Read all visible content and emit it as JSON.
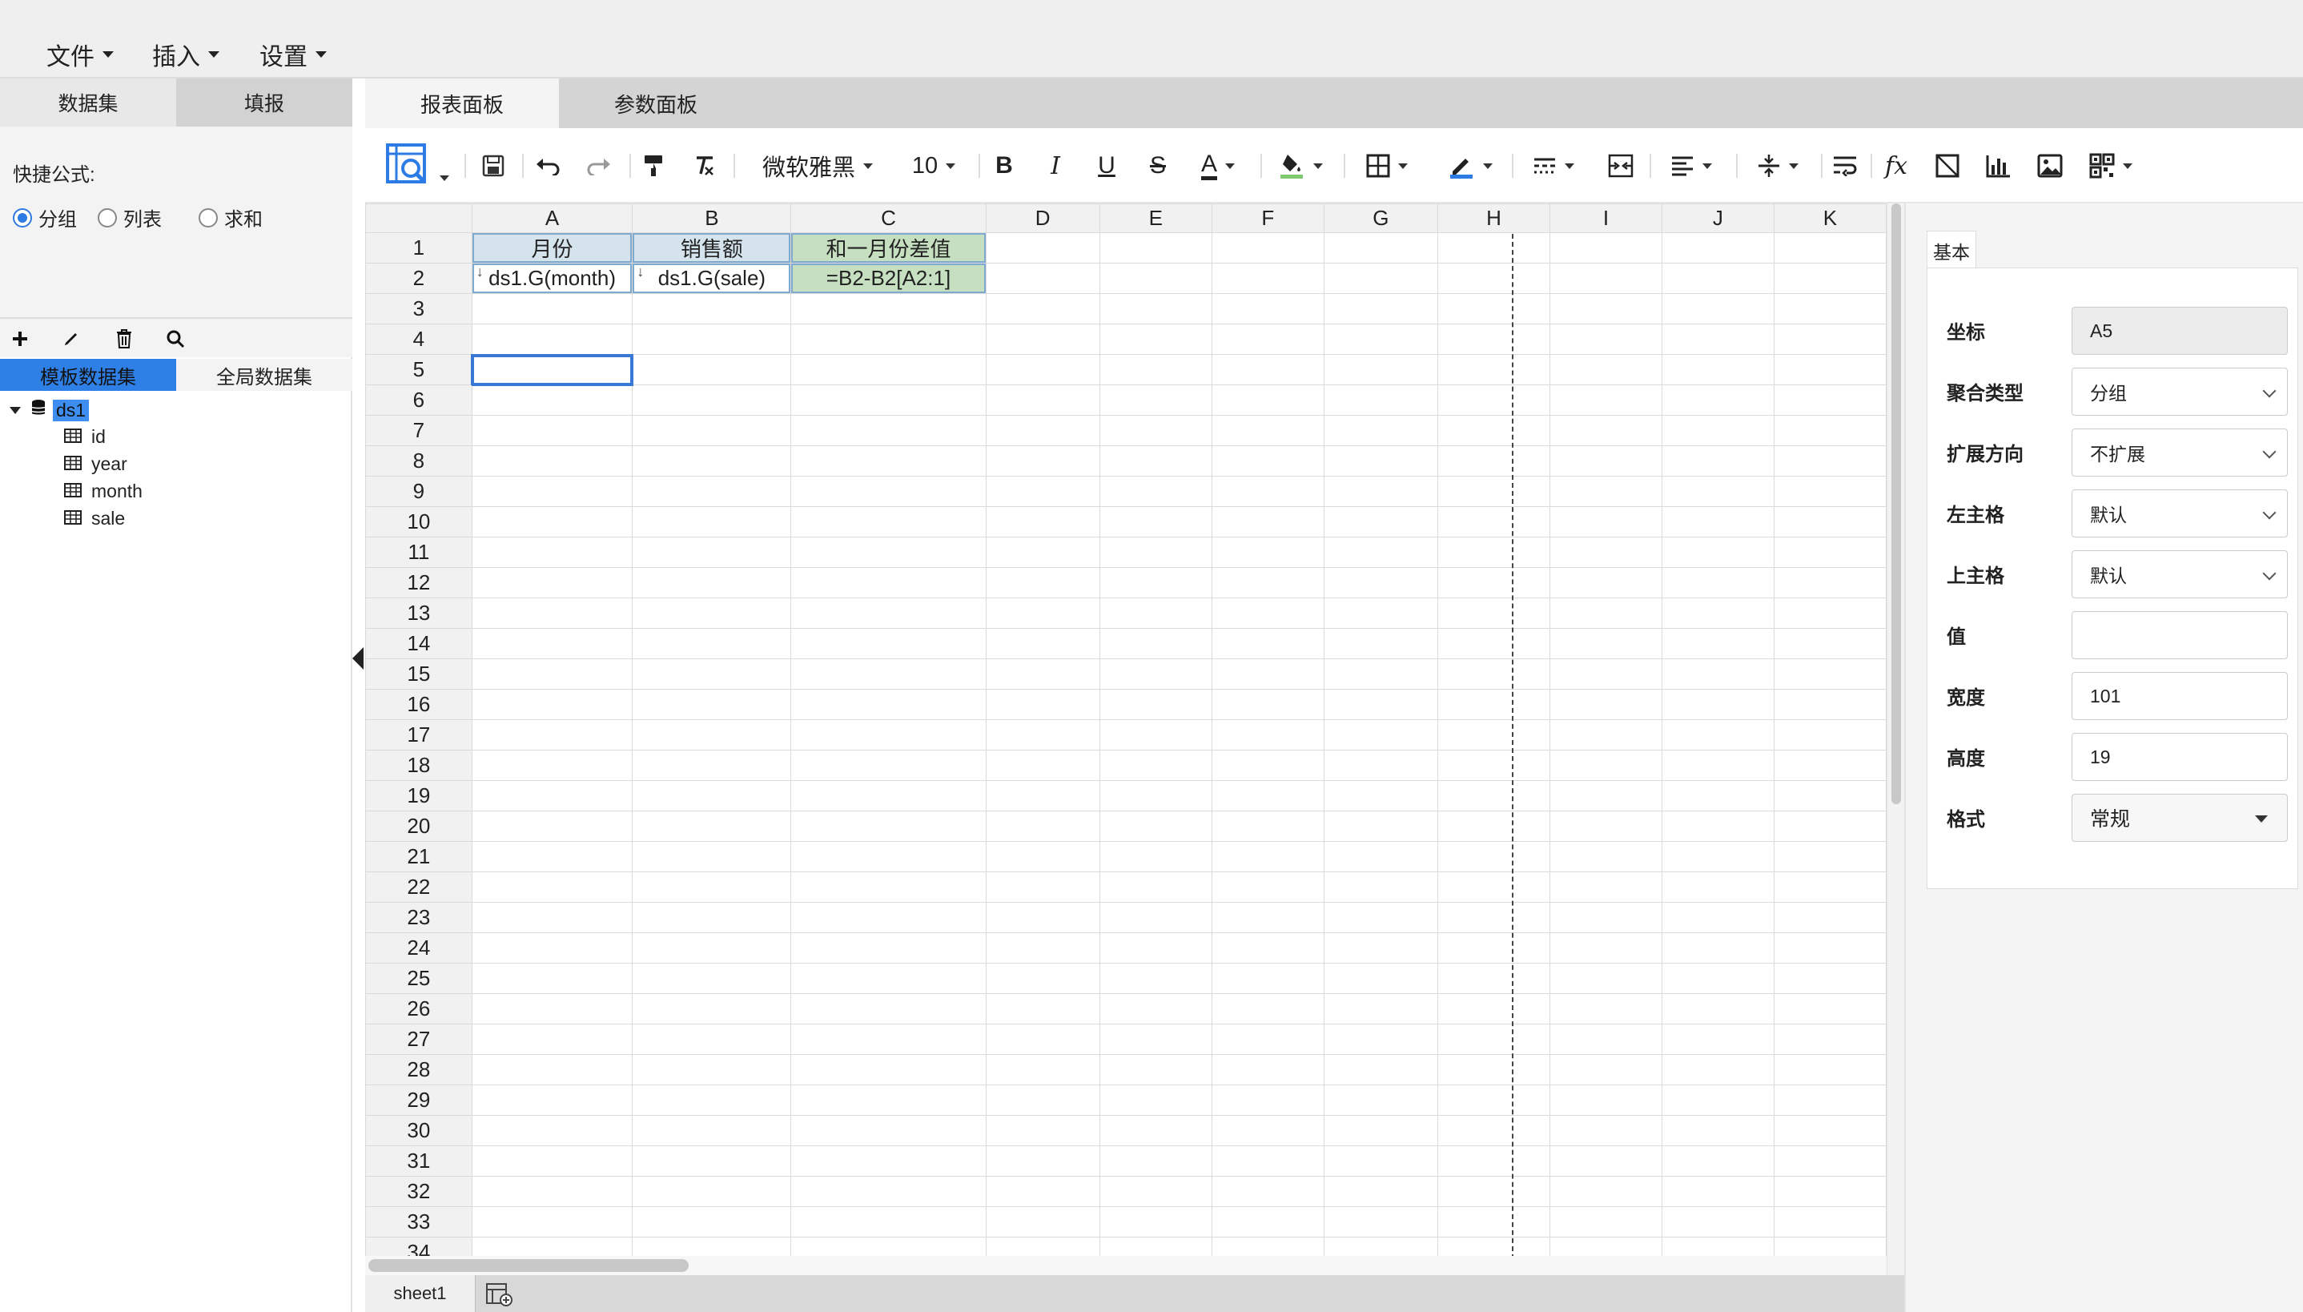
{
  "menubar": {
    "items": [
      {
        "label": "文件"
      },
      {
        "label": "插入"
      },
      {
        "label": "设置"
      }
    ]
  },
  "left_panel": {
    "tabs": [
      {
        "label": "数据集",
        "active": true
      },
      {
        "label": "填报",
        "active": false
      }
    ],
    "quick_formula_label": "快捷公式:",
    "radios": [
      {
        "label": "分组",
        "checked": true
      },
      {
        "label": "列表",
        "checked": false
      },
      {
        "label": "求和",
        "checked": false
      }
    ],
    "tools": [
      "plus-icon",
      "pencil-icon",
      "trash-icon",
      "search-icon"
    ],
    "dataset_tabs": [
      {
        "label": "模板数据集",
        "active": true
      },
      {
        "label": "全局数据集",
        "active": false
      }
    ],
    "tree": {
      "root": "ds1",
      "fields": [
        "id",
        "year",
        "month",
        "sale"
      ]
    }
  },
  "center_tabs": [
    {
      "label": "报表面板",
      "active": true
    },
    {
      "label": "参数面板",
      "active": false
    }
  ],
  "toolbar": {
    "font_name": "微软雅黑",
    "font_size": "10",
    "bold": "B",
    "italic": "I",
    "underline": "U",
    "strike": "S",
    "font_color": "A",
    "fx": "fx"
  },
  "sheet": {
    "columns": [
      "A",
      "B",
      "C",
      "D",
      "E",
      "F",
      "G",
      "H",
      "I",
      "J",
      "K"
    ],
    "row_count": 34,
    "cells": {
      "A1": "月份",
      "B1": "销售额",
      "C1": "和一月份差值",
      "A2": "ds1.G(month)",
      "B2": "ds1.G(sale)",
      "C2": "=B2-B2[A2:1]"
    },
    "selected_cell": "A5",
    "colors": {
      "header_fill": "#d4e3ec",
      "formula_fill": "#c6dfc0",
      "selection": "#3a78d6"
    }
  },
  "sheet_tabs": [
    {
      "label": "sheet1"
    }
  ],
  "properties": {
    "tab": "基本",
    "fields": [
      {
        "label": "坐标",
        "value": "A5",
        "kind": "readonly"
      },
      {
        "label": "聚合类型",
        "value": "分组",
        "kind": "select"
      },
      {
        "label": "扩展方向",
        "value": "不扩展",
        "kind": "select"
      },
      {
        "label": "左主格",
        "value": "默认",
        "kind": "select"
      },
      {
        "label": "上主格",
        "value": "默认",
        "kind": "select"
      },
      {
        "label": "值",
        "value": "",
        "kind": "input"
      },
      {
        "label": "宽度",
        "value": "101",
        "kind": "input"
      },
      {
        "label": "高度",
        "value": "19",
        "kind": "input"
      },
      {
        "label": "格式",
        "value": "常规",
        "kind": "dropdown"
      }
    ]
  }
}
